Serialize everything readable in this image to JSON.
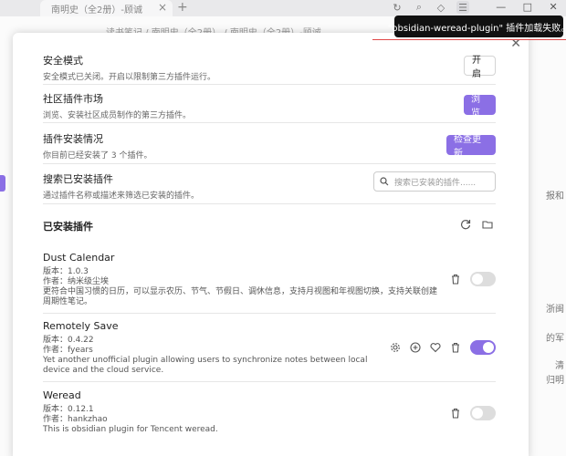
{
  "window": {
    "tab_title": "南明史（全2册）-顾诚",
    "breadcrumb": "读书笔记 / 南明史（全2册） / 南明史（全2册）-顾诚",
    "bg_right_texts": [
      "报和",
      "浙闽",
      "的军",
      "清",
      "归明"
    ]
  },
  "notice": {
    "text": "\"obsidian-weread-plugin\" 插件加载失败。"
  },
  "settings": {
    "safe_mode": {
      "name": "安全模式",
      "desc": "安全模式已关闭。开启以限制第三方插件运行。",
      "button": "开启"
    },
    "market": {
      "name": "社区插件市场",
      "desc": "浏览、安装社区成员制作的第三方插件。",
      "button": "浏览"
    },
    "install_status": {
      "name": "插件安装情况",
      "desc": "你目前已经安装了 3 个插件。",
      "button": "检查更新"
    },
    "search": {
      "name": "搜索已安装插件",
      "desc": "通过插件名称或描述来筛选已安装的插件。",
      "placeholder": "搜索已安装的插件......"
    }
  },
  "installed": {
    "title": "已安装插件",
    "plugins": [
      {
        "name": "Dust Calendar",
        "version": "版本：1.0.3",
        "author": "作者：纳米级尘埃",
        "desc": "更符合中国习惯的日历，可以显示农历、节气、节假日、调休信息，支持月视图和年视图切换，支持关联创建周期性笔记。",
        "enabled": false
      },
      {
        "name": "Remotely Save",
        "version": "版本：0.4.22",
        "author": "作者：fyears",
        "desc": "Yet another unofficial plugin allowing users to synchronize notes between local device and the cloud service.",
        "enabled": true
      },
      {
        "name": "Weread",
        "version": "版本：0.12.1",
        "author": "作者：hankzhao",
        "desc": "This is obsidian plugin for Tencent weread.",
        "enabled": false
      }
    ]
  },
  "colors": {
    "accent": "#8b6fe5",
    "notice_bg": "#111111",
    "notice_line": "#e04848"
  }
}
